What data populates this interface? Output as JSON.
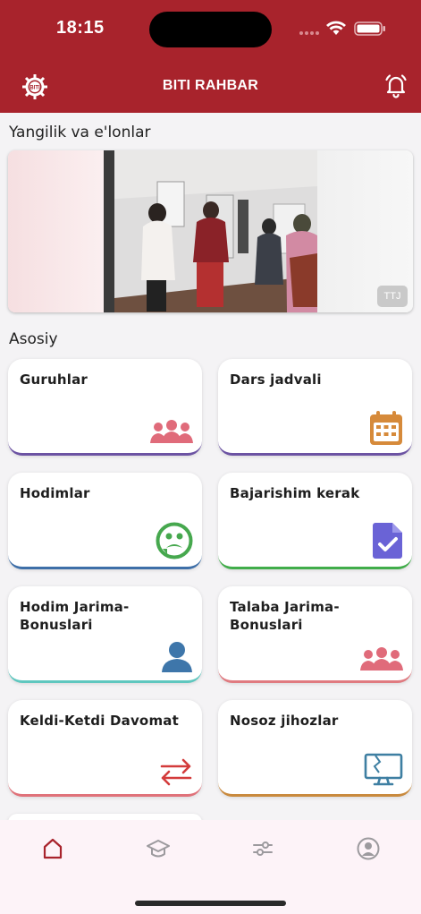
{
  "status_bar": {
    "time": "18:15"
  },
  "header": {
    "title": "BITI RAHBAR"
  },
  "news": {
    "title": "Yangilik va e'lonlar",
    "badge": "TTJ"
  },
  "main": {
    "title": "Asosiy"
  },
  "cards": [
    {
      "label": "Guruhlar",
      "icon": "group-icon",
      "color": "#e06b7a"
    },
    {
      "label": "Dars jadvali",
      "icon": "calendar-icon",
      "color": "#d68a3a"
    },
    {
      "label": "Hodimlar",
      "icon": "face-icon",
      "color": "#46a84e"
    },
    {
      "label": "Bajarishim kerak",
      "icon": "document-check-icon",
      "color": "#6a63d6"
    },
    {
      "label": "Hodim Jarima-Bonuslari",
      "icon": "person-icon",
      "color": "#3e76aa"
    },
    {
      "label": "Talaba Jarima-Bonuslari",
      "icon": "group-icon",
      "color": "#e06b7a"
    },
    {
      "label": "Keldi-Ketdi Davomat",
      "icon": "swap-arrows-icon",
      "color": "#d33b3b"
    },
    {
      "label": "Nosoz jihozlar",
      "icon": "broken-monitor-icon",
      "color": "#3e7fa2"
    }
  ],
  "bottom_nav": [
    {
      "name": "home-icon",
      "active": true
    },
    {
      "name": "graduation-cap-icon",
      "active": false
    },
    {
      "name": "sliders-icon",
      "active": false
    },
    {
      "name": "profile-icon",
      "active": false
    }
  ],
  "colors": {
    "brand": "#a8232c",
    "background": "#f4f3f5",
    "nav_background": "#fdf3f8"
  }
}
